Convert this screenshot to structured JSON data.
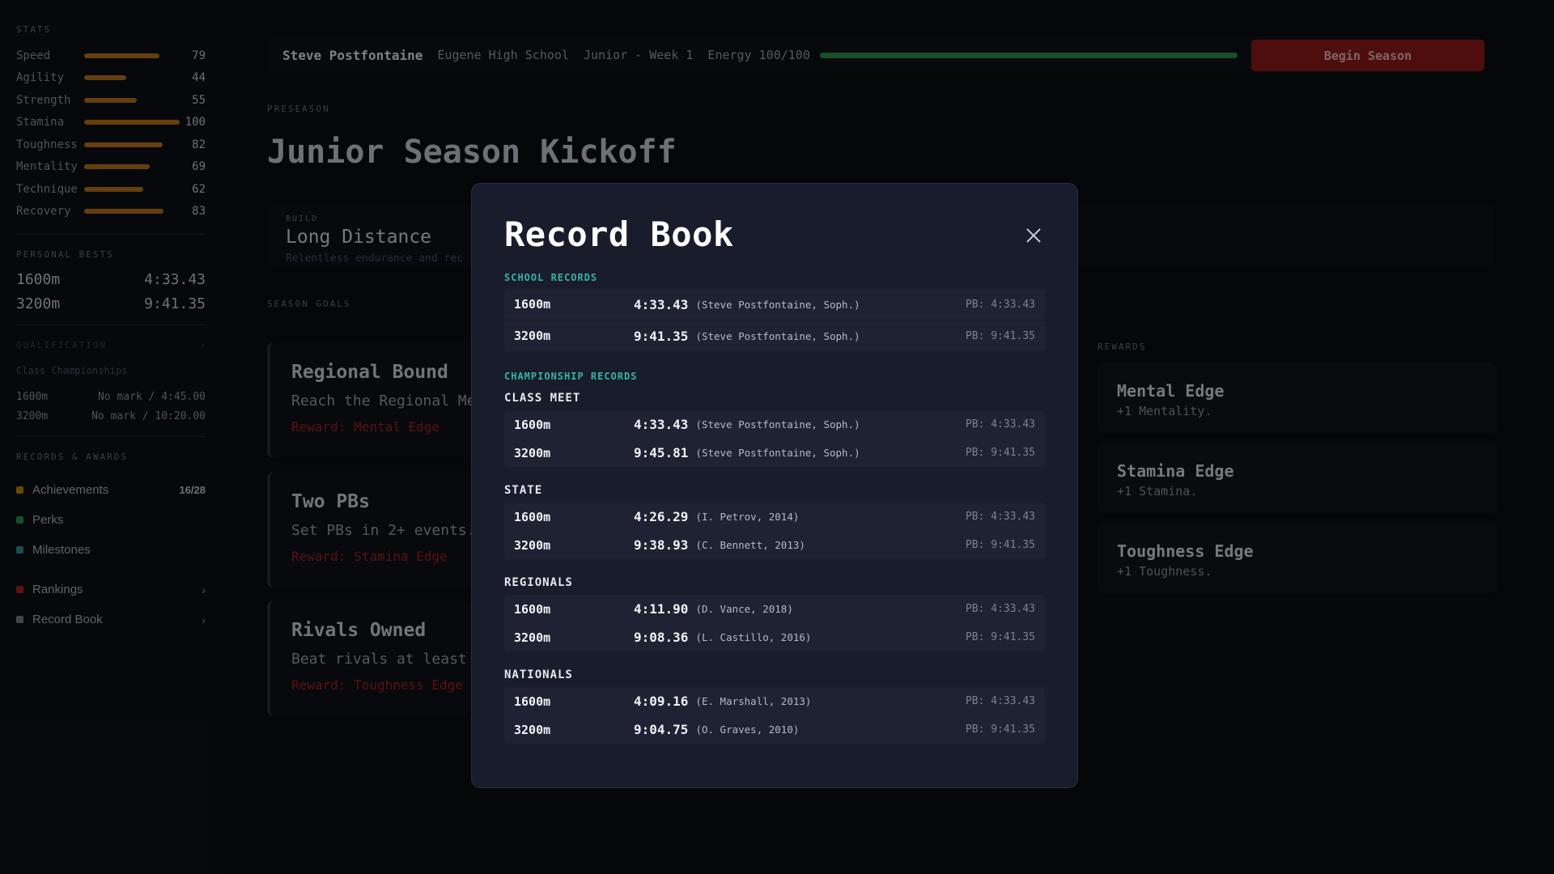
{
  "sidebar": {
    "stats_title": "STATS",
    "stats": [
      {
        "name": "Speed",
        "value": 79
      },
      {
        "name": "Agility",
        "value": 44
      },
      {
        "name": "Strength",
        "value": 55
      },
      {
        "name": "Stamina",
        "value": 100
      },
      {
        "name": "Toughness",
        "value": 82
      },
      {
        "name": "Mentality",
        "value": 69
      },
      {
        "name": "Technique",
        "value": 62
      },
      {
        "name": "Recovery",
        "value": 83
      }
    ],
    "stat_bar_color": "#b87416",
    "personal_bests_title": "PERSONAL BESTS",
    "personal_bests": [
      {
        "event": "1600m",
        "time": "4:33.43"
      },
      {
        "event": "3200m",
        "time": "9:41.35"
      }
    ],
    "qualification_title": "QUALIFICATION",
    "qualification_subtitle": "Class Championships",
    "qualification": [
      {
        "event": "1600m",
        "mark": "No mark / 4:45.00"
      },
      {
        "event": "3200m",
        "mark": "No mark / 10:20.00"
      }
    ],
    "records_title": "RECORDS & AWARDS",
    "awards": [
      {
        "label": "Achievements",
        "count": "16/28",
        "color": "#b8860b"
      },
      {
        "label": "Perks",
        "color": "#2f8f4a"
      },
      {
        "label": "Milestones",
        "color": "#2e8f8a"
      }
    ],
    "links": [
      {
        "label": "Rankings",
        "color": "#b22222"
      },
      {
        "label": "Record Book",
        "color": "#7a7f8c"
      }
    ]
  },
  "topbar": {
    "name": "Steve Postfontaine",
    "school": "Eugene High School",
    "week": "Junior - Week 1",
    "energy_label": "Energy 100/100",
    "energy_fraction": 1.0,
    "begin_button": "Begin Season"
  },
  "main": {
    "phase": "PRESEASON",
    "title": "Junior Season Kickoff",
    "build_label": "BUILD",
    "build_name": "Long Distance",
    "build_desc": "Relentless endurance and rec",
    "goals_title": "SEASON GOALS",
    "goals": [
      {
        "title": "Regional Bound",
        "desc": "Reach the Regional Me",
        "reward": "Reward: Mental Edge"
      },
      {
        "title": "Two PBs",
        "desc": "Set PBs in 2+ events.",
        "reward": "Reward: Stamina Edge"
      },
      {
        "title": "Rivals Owned",
        "desc": "Beat rivals at least",
        "reward": "Reward: Toughness Edge"
      }
    ],
    "rewards_title": "REWARDS",
    "rewards": [
      {
        "name": "Mental Edge",
        "desc": "+1 Mentality."
      },
      {
        "name": "Stamina Edge",
        "desc": "+1 Stamina."
      },
      {
        "name": "Toughness Edge",
        "desc": "+1 Toughness."
      }
    ]
  },
  "modal": {
    "title": "Record Book",
    "school_records_title": "SCHOOL RECORDS",
    "school_records": [
      {
        "event": "1600m",
        "time": "4:33.43",
        "holder": "(Steve Postfontaine, Soph.)",
        "pb": "PB: 4:33.43"
      },
      {
        "event": "3200m",
        "time": "9:41.35",
        "holder": "(Steve Postfontaine, Soph.)",
        "pb": "PB: 9:41.35"
      }
    ],
    "championship_title": "CHAMPIONSHIP RECORDS",
    "meets": [
      {
        "name": "CLASS MEET",
        "records": [
          {
            "event": "1600m",
            "time": "4:33.43",
            "holder": "(Steve Postfontaine, Soph.)",
            "pb": "PB: 4:33.43"
          },
          {
            "event": "3200m",
            "time": "9:45.81",
            "holder": "(Steve Postfontaine, Soph.)",
            "pb": "PB: 9:41.35"
          }
        ]
      },
      {
        "name": "STATE",
        "records": [
          {
            "event": "1600m",
            "time": "4:26.29",
            "holder": "(I. Petrov, 2014)",
            "pb": "PB: 4:33.43"
          },
          {
            "event": "3200m",
            "time": "9:38.93",
            "holder": "(C. Bennett, 2013)",
            "pb": "PB: 9:41.35"
          }
        ]
      },
      {
        "name": "REGIONALS",
        "records": [
          {
            "event": "1600m",
            "time": "4:11.90",
            "holder": "(D. Vance, 2018)",
            "pb": "PB: 4:33.43"
          },
          {
            "event": "3200m",
            "time": "9:08.36",
            "holder": "(L. Castillo, 2016)",
            "pb": "PB: 9:41.35"
          }
        ]
      },
      {
        "name": "NATIONALS",
        "records": [
          {
            "event": "1600m",
            "time": "4:09.16",
            "holder": "(E. Marshall, 2013)",
            "pb": "PB: 4:33.43"
          },
          {
            "event": "3200m",
            "time": "9:04.75",
            "holder": "(O. Graves, 2010)",
            "pb": "PB: 9:41.35"
          }
        ]
      }
    ],
    "accent_color": "#34b3a7",
    "close_icon": "close-icon"
  }
}
